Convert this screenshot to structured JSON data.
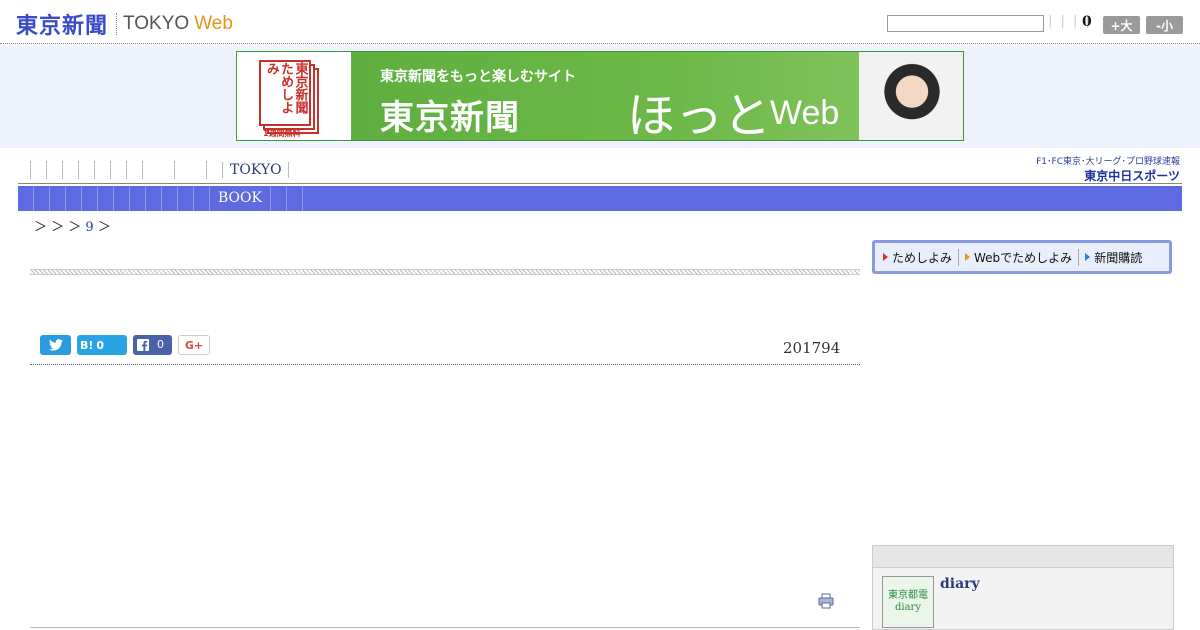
{
  "header": {
    "logo_jp": "東京新聞",
    "logo_en": "TOKYO",
    "logo_web": "Web",
    "search_placeholder": "",
    "count": "0",
    "font_up_label": "+大",
    "font_down_label": "-小"
  },
  "banner": {
    "book_text": "東京新聞 ためしよみ",
    "book_free": "1週間無料",
    "tagline": "東京新聞をもっと楽しむサイト",
    "title": "東京新聞",
    "hotto": "ほっと",
    "web": "Web"
  },
  "nav": {
    "tokyo_label": "TOKYO"
  },
  "sports": {
    "top": "F1･FC東京･大リーグ･プロ野球速報",
    "name": "東京中日スポーツ"
  },
  "category": {
    "book_label": "BOOK"
  },
  "breadcrumb": {
    "text_before": "＞ ＞ ＞",
    "number": "9",
    "text_after": "＞"
  },
  "article": {
    "date": "201794",
    "hatebu_count": "0",
    "fb_count": "0",
    "gplus_label": "G+"
  },
  "sidebar": {
    "sub_items": [
      "ためしよみ",
      "Webでためしよみ",
      "新聞購読"
    ],
    "diary_thumb_lines": [
      "東京都電",
      "diary"
    ],
    "diary_label": "diary"
  },
  "colors": {
    "brand_blue": "#3a4bc6",
    "web_orange": "#e8921d",
    "category_bar": "#5e6ae0",
    "banner_green": "#6cb848"
  }
}
